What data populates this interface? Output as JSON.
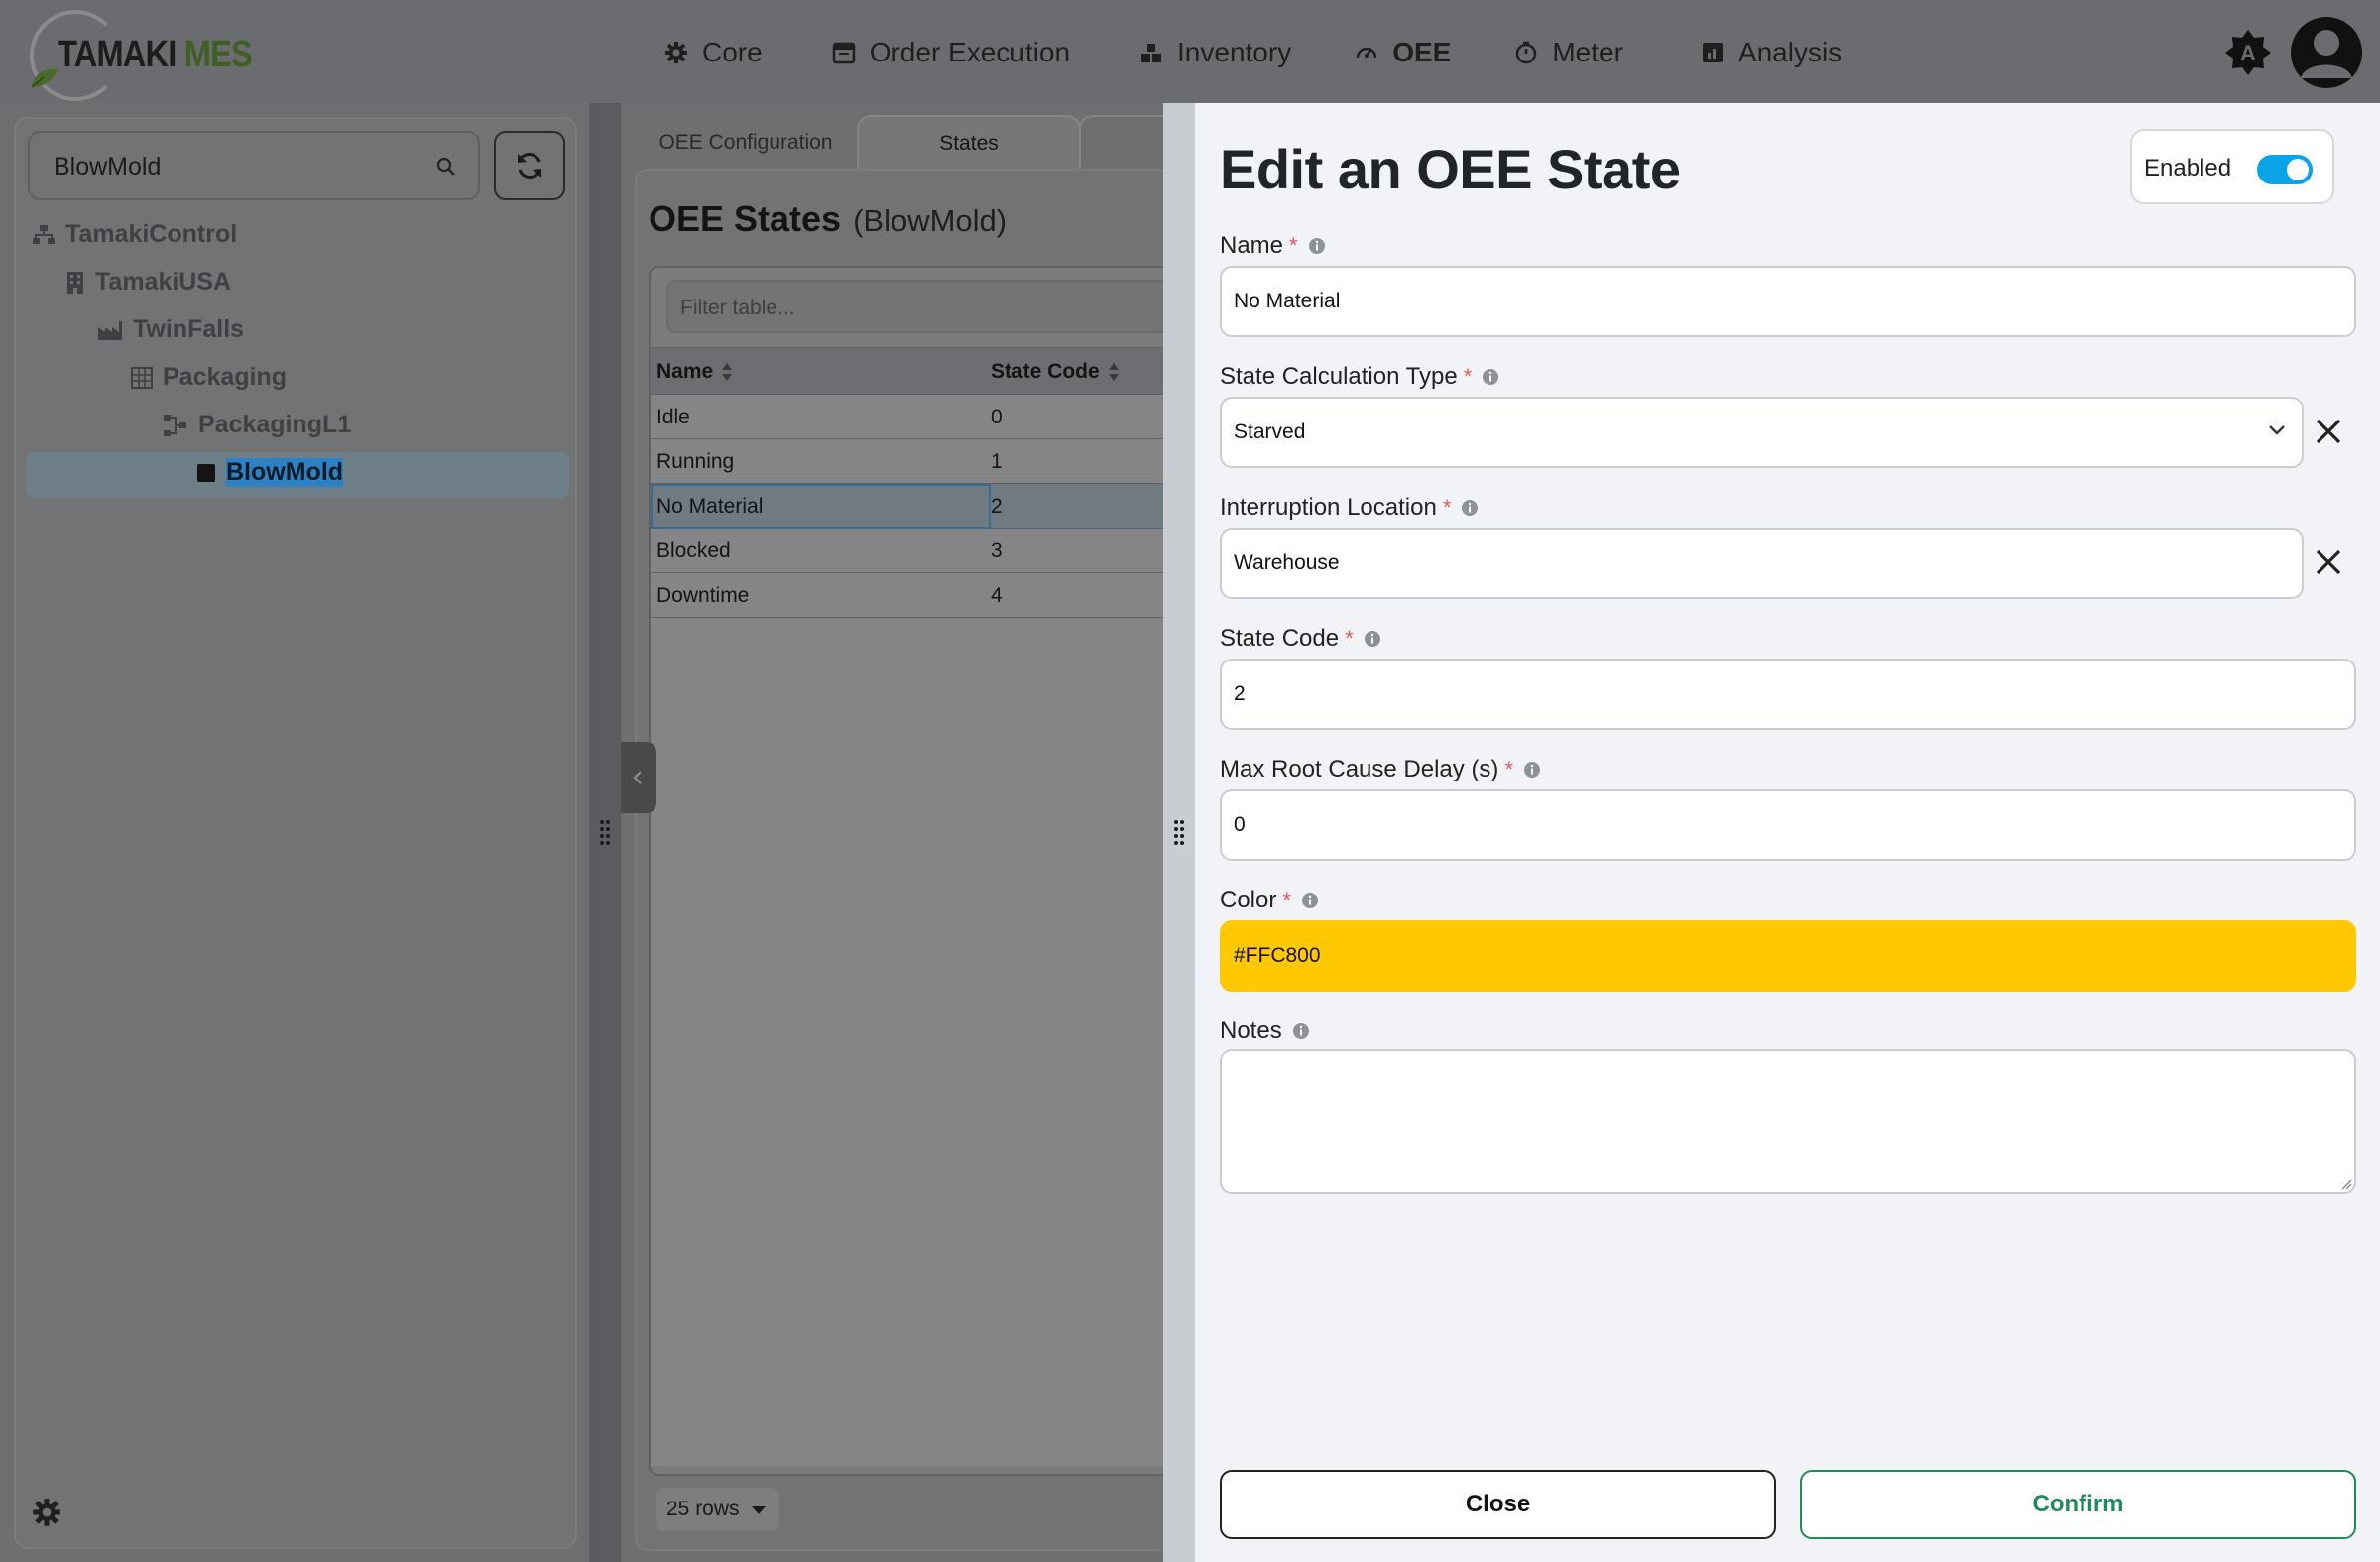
{
  "app": {
    "logo_word1": "TAMAKI",
    "logo_word2": "MES",
    "brand_color": "#4a6b2c"
  },
  "nav": {
    "items": [
      {
        "label": "Core",
        "icon": "gear-icon"
      },
      {
        "label": "Order Execution",
        "icon": "calendar-icon"
      },
      {
        "label": "Inventory",
        "icon": "boxes-icon"
      },
      {
        "label": "OEE",
        "icon": "speedometer-icon",
        "active": true
      },
      {
        "label": "Meter",
        "icon": "timer-icon"
      },
      {
        "label": "Analysis",
        "icon": "chart-icon"
      }
    ],
    "theme_button_letter": "A"
  },
  "tree": {
    "search_value": "BlowMold",
    "items": [
      {
        "label": "TamakiControl",
        "icon": "hierarchy-icon"
      },
      {
        "label": "TamakiUSA",
        "icon": "building-icon"
      },
      {
        "label": "TwinFalls",
        "icon": "factory-icon"
      },
      {
        "label": "Packaging",
        "icon": "grid-icon"
      },
      {
        "label": "PackagingL1",
        "icon": "line-icon"
      },
      {
        "label": "BlowMold",
        "icon": "square-icon",
        "selected": true
      }
    ]
  },
  "middle": {
    "tabs": [
      "OEE Configuration",
      "States"
    ],
    "active_tab": "States",
    "title": "OEE States",
    "subtitle": "(BlowMold)",
    "filter_placeholder": "Filter table...",
    "columns": [
      "Name",
      "State Code"
    ],
    "rows": [
      {
        "name": "Idle",
        "code": "0"
      },
      {
        "name": "Running",
        "code": "1"
      },
      {
        "name": "No Material",
        "code": "2",
        "selected": true
      },
      {
        "name": "Blocked",
        "code": "3"
      },
      {
        "name": "Downtime",
        "code": "4"
      }
    ],
    "rows_per_page": "25 rows"
  },
  "drawer": {
    "title": "Edit an OEE State",
    "enabled_label": "Enabled",
    "enabled": true,
    "fields": {
      "name": {
        "label": "Name",
        "value": "No Material"
      },
      "calc_type": {
        "label": "State Calculation Type",
        "value": "Starved"
      },
      "location": {
        "label": "Interruption Location",
        "value": "Warehouse"
      },
      "state_code": {
        "label": "State Code",
        "value": "2"
      },
      "max_delay": {
        "label": "Max Root Cause Delay (s)",
        "value": "0"
      },
      "color": {
        "label": "Color",
        "value": "#FFC800"
      },
      "notes": {
        "label": "Notes",
        "value": ""
      }
    },
    "required_mark": "*",
    "close_label": "Close",
    "confirm_label": "Confirm",
    "accent_color": "#0aa3e6",
    "confirm_color": "#1f8a5b"
  }
}
